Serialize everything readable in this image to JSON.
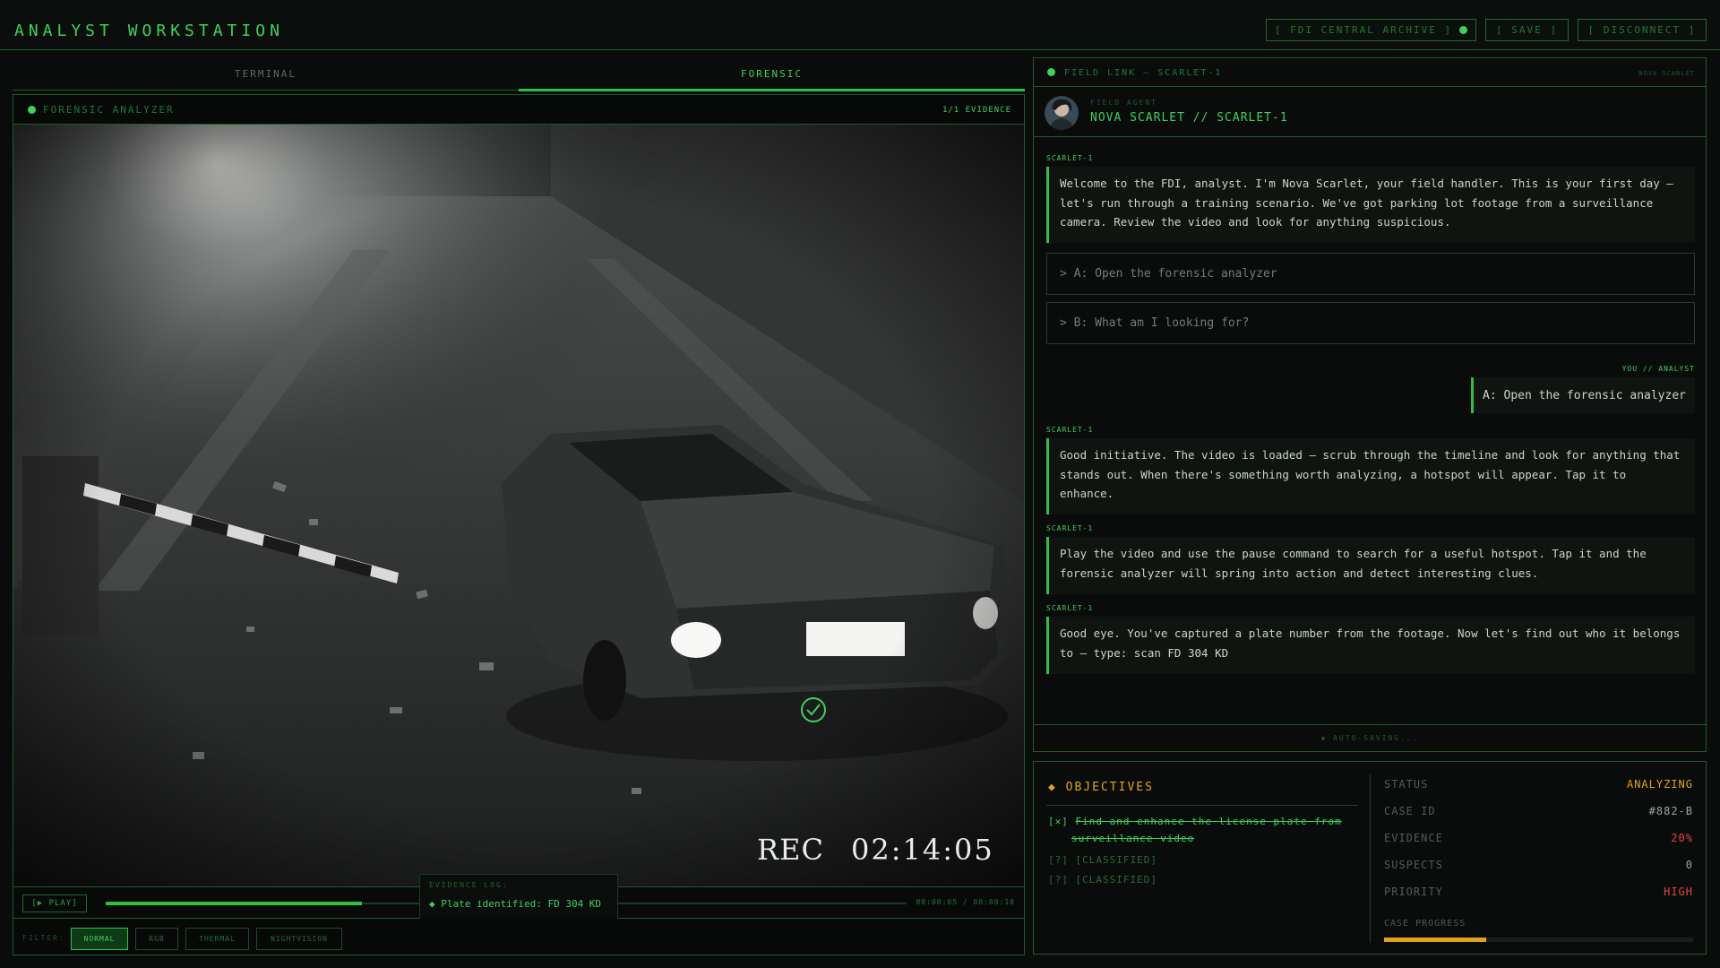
{
  "app": {
    "title": "ANALYST WORKSTATION"
  },
  "toolbar": {
    "archive_label": "[ FDI CENTRAL ARCHIVE ]",
    "save_label": "[ SAVE ]",
    "disconnect_label": "[ DISCONNECT ]"
  },
  "tabs": [
    {
      "label": "TERMINAL",
      "active": false
    },
    {
      "label": "FORENSIC",
      "active": true
    }
  ],
  "analyzer": {
    "title": "FORENSIC ANALYZER",
    "evidence_count": "1/1 EVIDENCE",
    "rec_label": "REC",
    "timecode": "02:14:05",
    "play_label": "[▶ PLAY]",
    "playback_progress": 0.32,
    "duration_text": "00:00:05 / 00:00:10",
    "evidence_log_label": "EVIDENCE LOG:",
    "evidence_log_item": "◆ Plate identified: FD 304 KD",
    "filter_label": "FILTER:",
    "filters": [
      {
        "label": "NORMAL",
        "active": true
      },
      {
        "label": "RGB",
        "active": false
      },
      {
        "label": "THERMAL",
        "active": false
      },
      {
        "label": "NIGHTVISION",
        "active": false
      }
    ]
  },
  "field_link": {
    "title": "FIELD LINK — SCARLET-1",
    "right_label": "NOVA SCARLET",
    "agent_label": "FIELD AGENT",
    "agent_name": "NOVA SCARLET // SCARLET-1",
    "messages": [
      {
        "sender": "SCARLET-1",
        "text": "Welcome to the FDI, analyst. I'm Nova Scarlet, your field handler. This is your first day — let's run through a training scenario. We've got parking lot footage from a surveillance camera. Review the video and look for anything suspicious."
      },
      {
        "sender": "SCARLET-1",
        "text": "Good initiative. The video is loaded — scrub through the timeline and look for anything that stands out. When there's something worth analyzing, a hotspot will appear. Tap it to enhance."
      },
      {
        "sender": "SCARLET-1",
        "text": "Play the video and use the pause command to search for a useful hotspot. Tap it and the forensic analyzer will spring into action and detect interesting clues."
      },
      {
        "sender": "SCARLET-1",
        "text": "Good eye. You've captured a plate number from the footage. Now let's find out who it belongs to — type: scan FD 304 KD"
      }
    ],
    "choices": [
      {
        "label": "> A: Open the forensic analyzer"
      },
      {
        "label": "> B: What am I looking for?"
      }
    ],
    "reply_label": "YOU // ANALYST",
    "reply_text": "A: Open the forensic analyzer",
    "autosave": "◆ AUTO-SAVING..."
  },
  "objectives": {
    "title": "◆ OBJECTIVES",
    "items": [
      {
        "mark": "[✕]",
        "text_line1": "Find and enhance the license plate from",
        "text_line2": "surveillance video",
        "done": true
      },
      {
        "mark": "[?]",
        "text_line1": "[CLASSIFIED]",
        "done": false
      },
      {
        "mark": "[?]",
        "text_line1": "[CLASSIFIED]",
        "done": false
      }
    ]
  },
  "case": {
    "status_label": "STATUS",
    "status_value": "ANALYZING",
    "id_label": "CASE ID",
    "id_value": "#882-B",
    "evidence_label": "EVIDENCE",
    "evidence_value": "20%",
    "suspects_label": "SUSPECTS",
    "suspects_value": "0",
    "priority_label": "PRIORITY",
    "priority_value": "HIGH",
    "progress_label": "CASE PROGRESS",
    "progress": 0.33
  },
  "colors": {
    "accent": "#3fd15a",
    "warning": "#e0a21a",
    "danger": "#e2453c"
  }
}
